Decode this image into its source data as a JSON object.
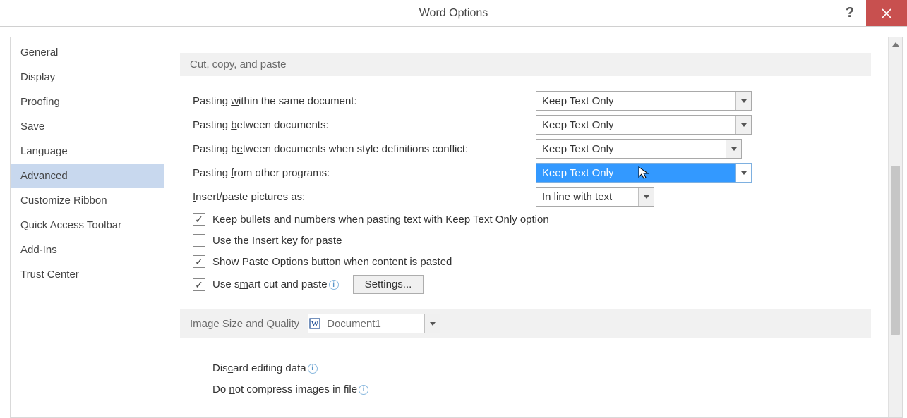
{
  "window": {
    "title": "Word Options",
    "help_label": "?",
    "close_label": "Close"
  },
  "sidebar": {
    "items": [
      {
        "label": "General"
      },
      {
        "label": "Display"
      },
      {
        "label": "Proofing"
      },
      {
        "label": "Save"
      },
      {
        "label": "Language"
      },
      {
        "label": "Advanced",
        "selected": true
      },
      {
        "label": "Customize Ribbon"
      },
      {
        "label": "Quick Access Toolbar"
      },
      {
        "label": "Add-Ins"
      },
      {
        "label": "Trust Center"
      }
    ]
  },
  "sections": {
    "cut_copy_paste": {
      "title": "Cut, copy, and paste",
      "paste_within_label": "Pasting within the same document:",
      "paste_within_value": "Keep Text Only",
      "paste_between_label": "Pasting between documents:",
      "paste_between_value": "Keep Text Only",
      "paste_between_conflict_label": "Pasting between documents when style definitions conflict:",
      "paste_between_conflict_value": "Keep Text Only",
      "paste_other_label": "Pasting from other programs:",
      "paste_other_value": "Keep Text Only",
      "insert_pictures_label": "Insert/paste pictures as:",
      "insert_pictures_value": "In line with text",
      "keep_bullets_label": "Keep bullets and numbers when pasting text with Keep Text Only option",
      "keep_bullets_checked": true,
      "use_insert_key_label": "Use the Insert key for paste",
      "use_insert_key_checked": false,
      "show_paste_options_label": "Show Paste Options button when content is pasted",
      "show_paste_options_checked": true,
      "use_smart_cut_label": "Use smart cut and paste",
      "use_smart_cut_checked": true,
      "settings_button": "Settings..."
    },
    "image_size_quality": {
      "title": "Image Size and Quality",
      "document_value": "Document1",
      "discard_editing_label": "Discard editing data",
      "discard_editing_checked": false,
      "do_not_compress_label": "Do not compress images in file",
      "do_not_compress_checked": false
    }
  }
}
